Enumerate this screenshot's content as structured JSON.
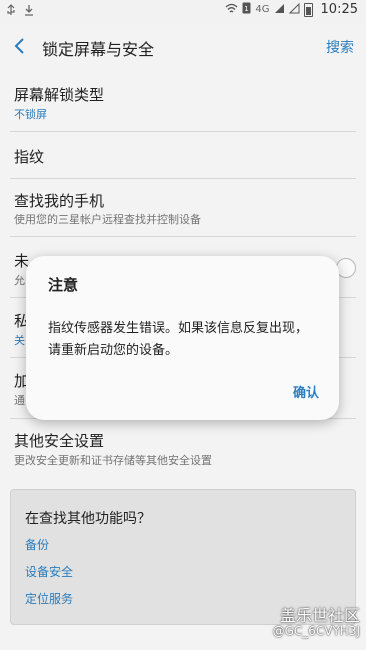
{
  "status_bar": {
    "time": "10:25",
    "network_label": "4G",
    "left_icons": [
      "usb-icon",
      "download-icon"
    ],
    "right_icons": [
      "wifi-icon",
      "sim-1-icon",
      "signal-icon",
      "signal-icon-2",
      "battery-icon"
    ]
  },
  "header": {
    "title": "锁定屏幕与安全",
    "search_label": "搜索"
  },
  "settings": [
    {
      "title": "屏幕解锁类型",
      "subtitle": "不锁屏"
    },
    {
      "title": "指纹",
      "subtitle": ""
    },
    {
      "title": "查找我的手机",
      "subtitle": "使用您的三星帐户远程查找并控制设备"
    },
    {
      "title": "未",
      "subtitle": "允"
    },
    {
      "title": "私",
      "subtitle": "关"
    },
    {
      "title": "加",
      "subtitle": "通"
    },
    {
      "title": "其他安全设置",
      "subtitle": "更改安全更新和证书存储等其他安全设置"
    }
  ],
  "dialog": {
    "title": "注意",
    "message": "指纹传感器发生错误。如果该信息反复出现，请重新启动您的设备。",
    "ok_label": "确认"
  },
  "suggestions": {
    "title": "在查找其他功能吗？",
    "links": [
      "备份",
      "设备安全",
      "定位服务"
    ]
  },
  "watermark": {
    "brand": "盖乐世社区",
    "user": "@GC_6CVYH3J"
  },
  "colors": {
    "accent": "#2b7fc1",
    "background": "#f8f8f8",
    "card": "#e6e6e6"
  }
}
